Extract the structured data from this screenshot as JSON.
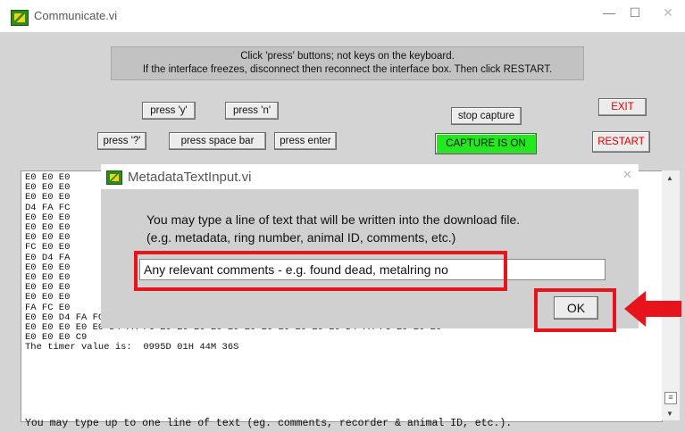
{
  "window": {
    "title": "Communicate.vi",
    "minimize": "—",
    "maximize": "☐",
    "close": "✕"
  },
  "instructions": {
    "line1": "Click 'press' buttons; not keys on the keyboard.",
    "line2": "If the interface freezes, disconnect then reconnect the interface box. Then click RESTART."
  },
  "buttons": {
    "press_y": "press 'y'",
    "press_n": "press 'n'",
    "press_q": "press '?'",
    "press_space": "press space bar",
    "press_enter": "press enter",
    "stop_capture": "stop capture",
    "capture_status": "CAPTURE IS ON",
    "exit": "EXIT",
    "restart": "RESTART"
  },
  "terminal": {
    "lines": "E0 E0 E0\nE0 E0 E0\nE0 E0 E0\nD4 FA FC\nE0 E0 E0\nE0 E0 E0\nE0 E0 E0\nFC E0 E0\nE0 D4 FA\nE0 E0 E0\nE0 E0 E0\nE0 E0 E0\nE0 E0 E0\nFA FC E0\nE0 E0 D4 FA FC E0 E0 E0 E0 E0 E0 E0 E0 E0 E0 E0 D4 FA FC E0 E0 E0 E0 E0 E0\nE0 E0 E0 E0 E0 D4 FA FC E0 E0 E0 E0 E0 E0 E0 E0 E0 E0 E0 D4 FA FC E0 E0 E0\nE0 E0 E0 C9\nThe timer value is:  0995D 01H 44M 36S",
    "prompt": "You may type up to one line of text (eg. comments, recorder & animal ID, etc.)."
  },
  "dialog": {
    "title": "MetadataTextInput.vi",
    "close": "✕",
    "message_line1": "You may type a line of text that will be written into the download file.",
    "message_line2": "(e.g. metadata, ring number, animal ID, comments, etc.)",
    "input_value": "Any relevant comments - e.g. found dead, metalring no",
    "ok": "OK"
  },
  "scrollbar": {
    "up": "▲",
    "down": "▼",
    "grip": "≡"
  },
  "colors": {
    "capture_on": "#22e81e",
    "exit_text": "#e00000",
    "highlight": "#e8141c"
  }
}
